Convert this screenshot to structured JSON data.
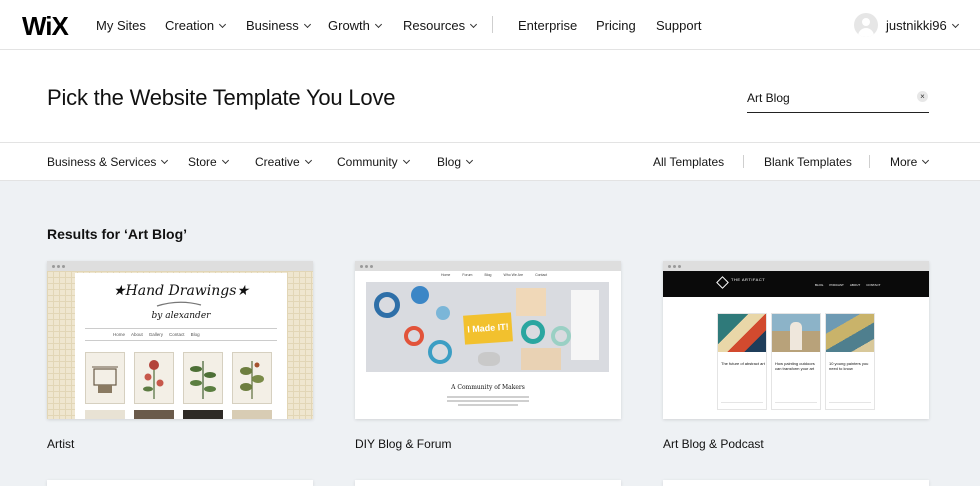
{
  "nav": {
    "logo": "WiX",
    "items": [
      "My Sites",
      "Creation",
      "Business",
      "Growth",
      "Resources",
      "Enterprise",
      "Pricing",
      "Support"
    ],
    "username": "justnikki96"
  },
  "header": {
    "title": "Pick the Website Template You Love",
    "search_value": "Art Blog",
    "clear_glyph": "×"
  },
  "categories": {
    "left": [
      "Business & Services",
      "Store",
      "Creative",
      "Community",
      "Blog"
    ],
    "right": [
      "All Templates",
      "Blank Templates",
      "More"
    ]
  },
  "results": {
    "heading": "Results for ‘Art Blog’",
    "templates": [
      {
        "name": "Artist",
        "preview": {
          "title": "★Hand Drawings★",
          "subtitle": "by alexander",
          "menu": [
            "Home",
            "About",
            "Gallery",
            "Contact",
            "Blog"
          ]
        }
      },
      {
        "name": "DIY Blog & Forum",
        "preview": {
          "menu": [
            "Home",
            "Forum",
            "Blog",
            "Who We Are",
            "Contact"
          ],
          "tag": "I Made IT!",
          "caption": "A Community of Makers"
        }
      },
      {
        "name": "Art Blog & Podcast",
        "preview": {
          "brand": "THE ARTIFACT",
          "menu": [
            "BLOG",
            "PODCAST",
            "ABOUT",
            "CONTACT"
          ],
          "posts": [
            "The future of abstract art",
            "How painting outdoors can transform your art",
            "10 young painters you need to know"
          ]
        }
      }
    ]
  },
  "colors": {
    "accent": "#116dff",
    "text": "#161616",
    "page_bg": "#eef1f4"
  },
  "icons": {
    "avatar": "user-avatar-icon",
    "chevron": "chevron-down-icon",
    "clear": "clear-search-icon"
  }
}
